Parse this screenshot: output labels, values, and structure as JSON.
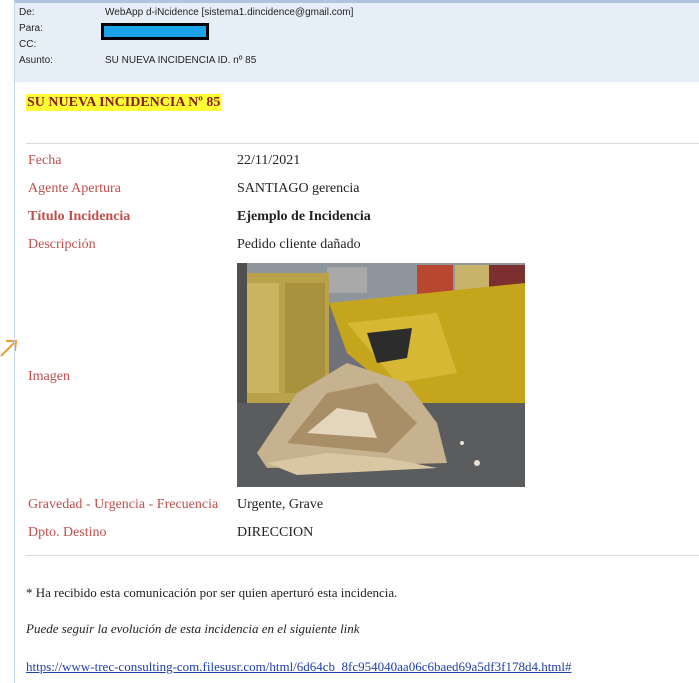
{
  "email_header": {
    "from_label": "De:",
    "from_value": "WebApp d-iNcidence [sistema1.dincidence@gmail.com]",
    "to_label": "Para:",
    "cc_label": "CC:",
    "subject_label": "Asunto:",
    "subject_value": "SU NUEVA INCIDENCIA ID. nº 85"
  },
  "body": {
    "title": "SU NUEVA INCIDENCIA Nº 85",
    "fields": [
      {
        "label": "Fecha",
        "value": "22/11/2021"
      },
      {
        "label": "Agente Apertura",
        "value": "SANTIAGO gerencia"
      },
      {
        "label": "Título Incidencia",
        "value": "Ejemplo de Incidencia"
      },
      {
        "label": "Descripción",
        "value": "Pedido cliente dañado"
      },
      {
        "label": "Imagen"
      },
      {
        "label": "Gravedad - Urgencia - Frecuencia",
        "value": "Urgente, Grave"
      },
      {
        "label": "Dpto. Destino",
        "value": "DIRECCION"
      }
    ],
    "notice": "* Ha recibido esta comunicación por ser quien aperturó esta incidencia.",
    "follow_text": "Puede seguir la evolución de esta incidencia en el siguiente link",
    "link": "https://www-trec-consulting-com.filesusr.com/html/6d64cb_8fc954040aa06c6baed69a5df3f178d4.html#"
  },
  "colors": {
    "label": "#c0504d",
    "title_highlight": "#ffff33",
    "header_bg": "#e6eff8",
    "redaction": "#1aa3e8",
    "link": "#1f3faa"
  }
}
